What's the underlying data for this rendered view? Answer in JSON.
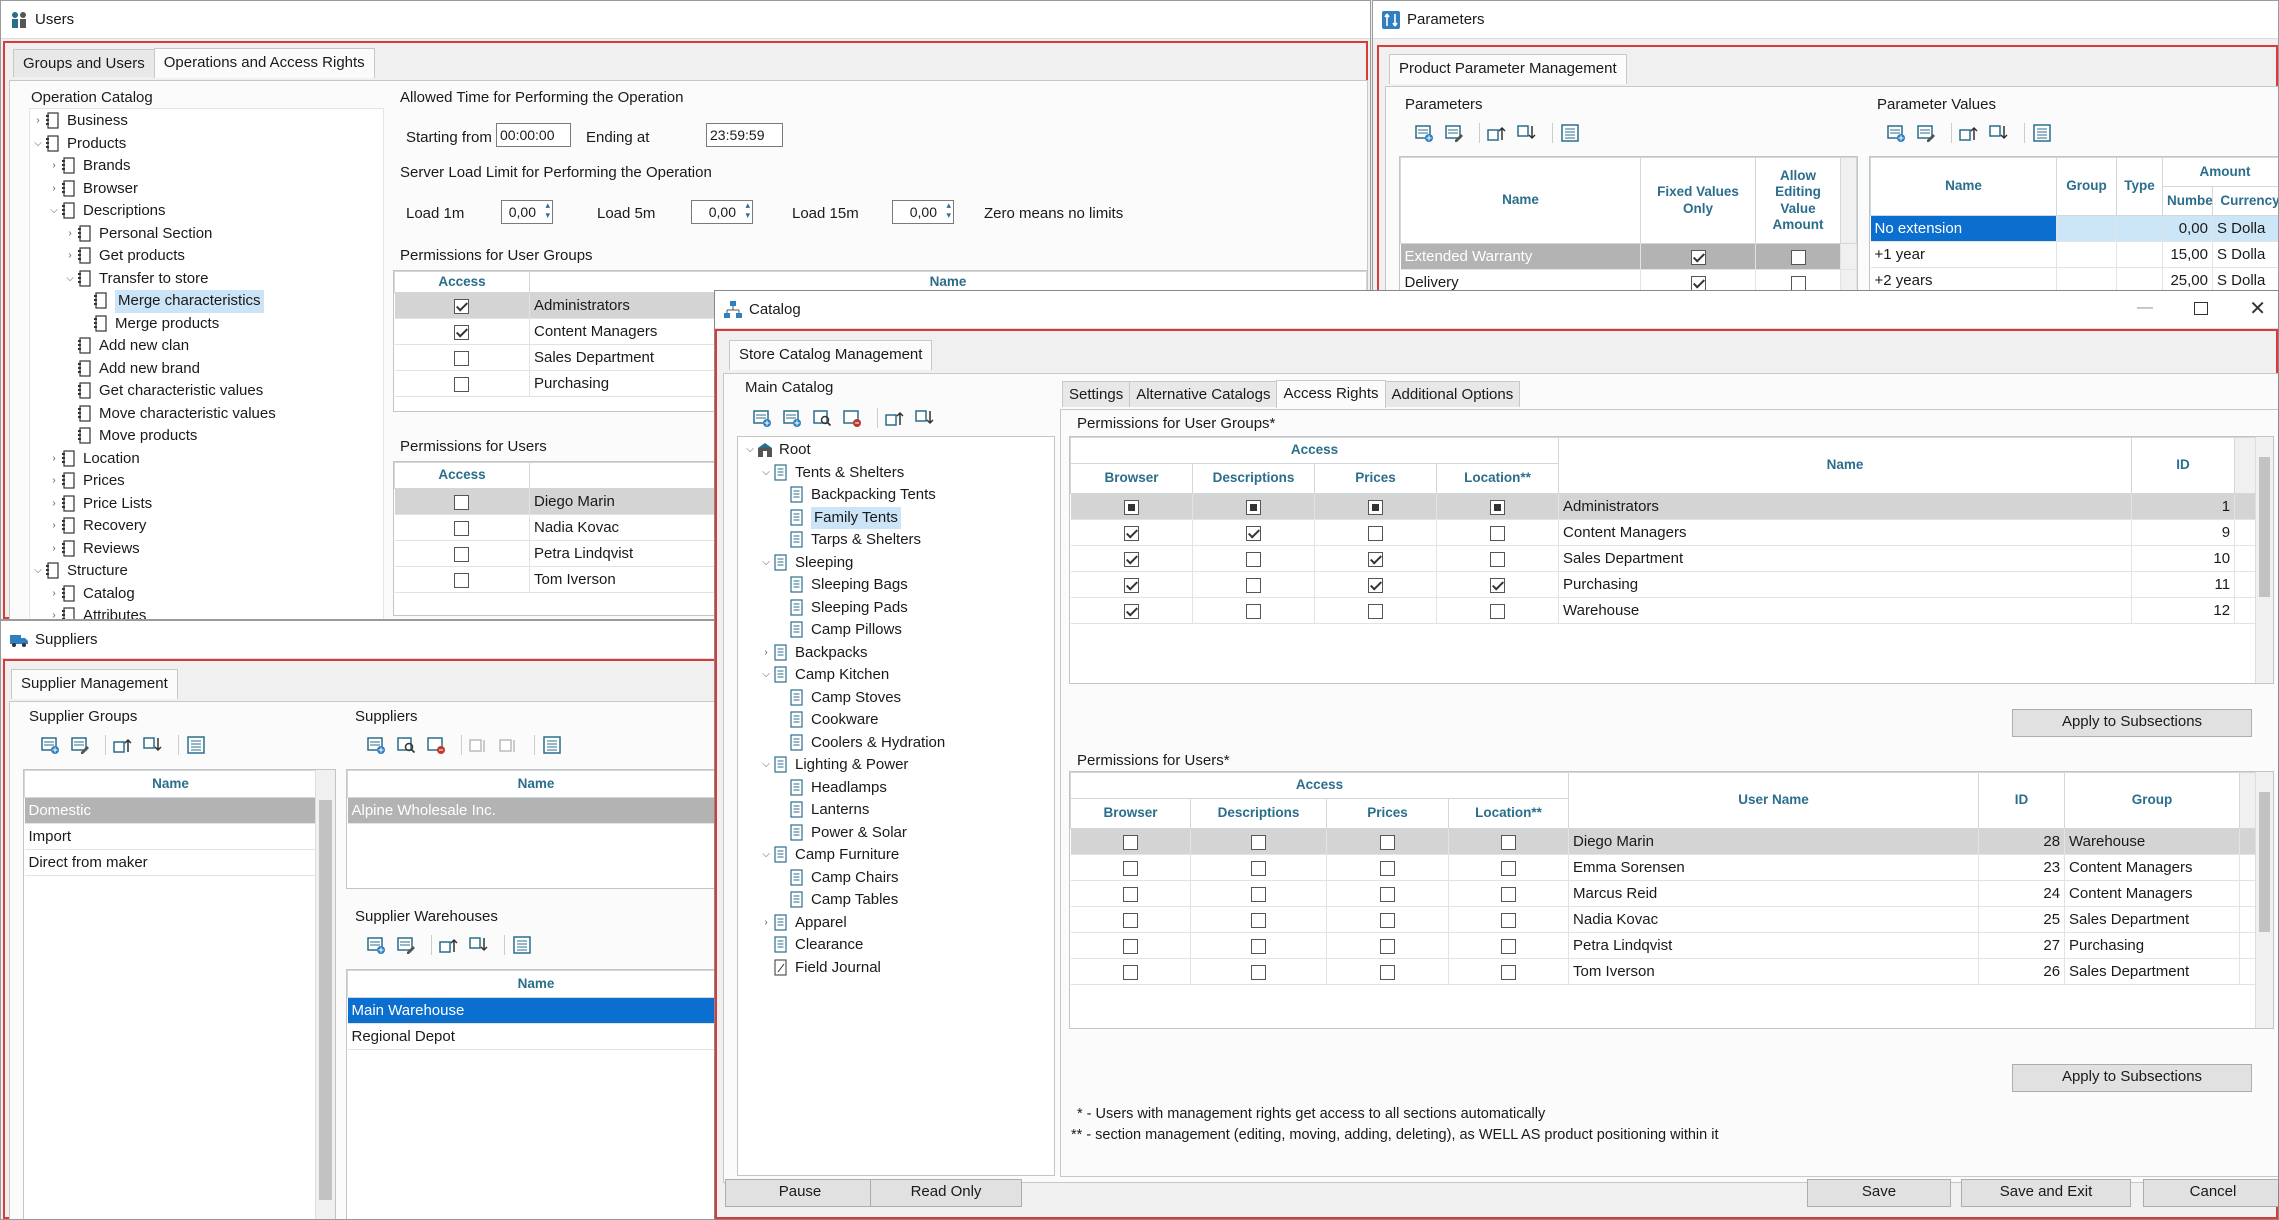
{
  "users_window": {
    "title": "Users",
    "tabs": [
      "Groups and Users",
      "Operations and Access Rights"
    ],
    "operation_catalog_label": "Operation Catalog",
    "tree": [
      {
        "label": "Business",
        "lvl": 0,
        "exp": "closed"
      },
      {
        "label": "Products",
        "lvl": 0,
        "exp": "open"
      },
      {
        "label": "Brands",
        "lvl": 1,
        "exp": "closed"
      },
      {
        "label": "Browser",
        "lvl": 1,
        "exp": "closed"
      },
      {
        "label": "Descriptions",
        "lvl": 1,
        "exp": "open"
      },
      {
        "label": "Personal Section",
        "lvl": 2,
        "exp": "closed"
      },
      {
        "label": "Get products",
        "lvl": 2,
        "exp": "closed"
      },
      {
        "label": "Transfer to store",
        "lvl": 2,
        "exp": "open"
      },
      {
        "label": "Merge characteristics",
        "lvl": 3,
        "exp": "",
        "selected": true
      },
      {
        "label": "Merge products",
        "lvl": 3,
        "exp": ""
      },
      {
        "label": "Add new clan",
        "lvl": 2,
        "exp": ""
      },
      {
        "label": "Add new brand",
        "lvl": 2,
        "exp": ""
      },
      {
        "label": "Get characteristic values",
        "lvl": 2,
        "exp": ""
      },
      {
        "label": "Move characteristic values",
        "lvl": 2,
        "exp": ""
      },
      {
        "label": "Move products",
        "lvl": 2,
        "exp": ""
      },
      {
        "label": "Location",
        "lvl": 1,
        "exp": "closed"
      },
      {
        "label": "Prices",
        "lvl": 1,
        "exp": "closed"
      },
      {
        "label": "Price Lists",
        "lvl": 1,
        "exp": "closed"
      },
      {
        "label": "Recovery",
        "lvl": 1,
        "exp": "closed"
      },
      {
        "label": "Reviews",
        "lvl": 1,
        "exp": "closed"
      },
      {
        "label": "Structure",
        "lvl": 0,
        "exp": "open"
      },
      {
        "label": "Catalog",
        "lvl": 1,
        "exp": "closed"
      },
      {
        "label": "Attributes",
        "lvl": 1,
        "exp": "closed"
      }
    ],
    "allowed_time_label": "Allowed Time for Performing the Operation",
    "starting_from_label": "Starting from",
    "starting_from_value": "00:00:00",
    "ending_at_label": "Ending at",
    "ending_at_value": "23:59:59",
    "server_load_label": "Server Load Limit for Performing the Operation",
    "load1_label": "Load 1m",
    "load1_value": "0,00",
    "load5_label": "Load 5m",
    "load5_value": "0,00",
    "load15_label": "Load 15m",
    "load15_value": "0,00",
    "zero_note": "Zero means no limits",
    "perm_groups_label": "Permissions for User Groups",
    "perm_groups_cols": [
      "Access",
      "Name"
    ],
    "perm_groups_rows": [
      {
        "access": true,
        "name": "Administrators"
      },
      {
        "access": true,
        "name": "Content Managers"
      },
      {
        "access": false,
        "name": "Sales Department"
      },
      {
        "access": false,
        "name": "Purchasing"
      }
    ],
    "perm_users_label": "Permissions for Users",
    "perm_users_cols": [
      "Access"
    ],
    "perm_users_rows": [
      {
        "access": false,
        "name": "Diego Marin"
      },
      {
        "access": false,
        "name": "Nadia Kovac"
      },
      {
        "access": false,
        "name": "Petra Lindqvist"
      },
      {
        "access": false,
        "name": "Tom Iverson"
      }
    ]
  },
  "parameters_window": {
    "title": "Parameters",
    "tab": "Product Parameter Management",
    "params_label": "Parameters",
    "params_cols": [
      "Name",
      "Fixed Values Only",
      "Allow Editing Value Amount"
    ],
    "params_rows": [
      {
        "name": "Extended Warranty",
        "fixed": true,
        "allow": false
      },
      {
        "name": "Delivery",
        "fixed": true,
        "allow": false
      }
    ],
    "values_label": "Parameter Values",
    "values_cols": [
      "Name",
      "Group",
      "Type",
      "Amount",
      "Number",
      "Currency"
    ],
    "values_rows": [
      {
        "name": "No extension",
        "number": "0,00",
        "currency": "S Dolla"
      },
      {
        "name": "+1 year",
        "number": "15,00",
        "currency": "S Dolla"
      },
      {
        "name": "+2 years",
        "number": "25,00",
        "currency": "S Dolla"
      }
    ]
  },
  "suppliers_window": {
    "title": "Suppliers",
    "tab": "Supplier Management",
    "groups_label": "Supplier Groups",
    "groups_col": "Name",
    "groups_rows": [
      "Domestic",
      "Import",
      "Direct from maker"
    ],
    "suppliers_label": "Suppliers",
    "suppliers_col": "Name",
    "suppliers_rows": [
      "Alpine Wholesale Inc."
    ],
    "warehouses_label": "Supplier Warehouses",
    "warehouses_col": "Name",
    "warehouses_rows": [
      "Main Warehouse",
      "Regional Depot"
    ]
  },
  "catalog_window": {
    "title": "Catalog",
    "tab": "Store Catalog Management",
    "main_catalog_label": "Main Catalog",
    "tree": [
      {
        "label": "Root",
        "lvl": 0,
        "exp": "open",
        "icon": "root"
      },
      {
        "label": "Tents & Shelters",
        "lvl": 1,
        "exp": "open"
      },
      {
        "label": "Backpacking Tents",
        "lvl": 2,
        "exp": ""
      },
      {
        "label": "Family Tents",
        "lvl": 2,
        "exp": "",
        "selected": true
      },
      {
        "label": "Tarps & Shelters",
        "lvl": 2,
        "exp": ""
      },
      {
        "label": "Sleeping",
        "lvl": 1,
        "exp": "open"
      },
      {
        "label": "Sleeping Bags",
        "lvl": 2,
        "exp": ""
      },
      {
        "label": "Sleeping Pads",
        "lvl": 2,
        "exp": ""
      },
      {
        "label": "Camp Pillows",
        "lvl": 2,
        "exp": ""
      },
      {
        "label": "Backpacks",
        "lvl": 1,
        "exp": "closed"
      },
      {
        "label": "Camp Kitchen",
        "lvl": 1,
        "exp": "open"
      },
      {
        "label": "Camp Stoves",
        "lvl": 2,
        "exp": ""
      },
      {
        "label": "Cookware",
        "lvl": 2,
        "exp": ""
      },
      {
        "label": "Coolers & Hydration",
        "lvl": 2,
        "exp": ""
      },
      {
        "label": "Lighting & Power",
        "lvl": 1,
        "exp": "open"
      },
      {
        "label": "Headlamps",
        "lvl": 2,
        "exp": ""
      },
      {
        "label": "Lanterns",
        "lvl": 2,
        "exp": ""
      },
      {
        "label": "Power & Solar",
        "lvl": 2,
        "exp": ""
      },
      {
        "label": "Camp Furniture",
        "lvl": 1,
        "exp": "open"
      },
      {
        "label": "Camp Chairs",
        "lvl": 2,
        "exp": ""
      },
      {
        "label": "Camp Tables",
        "lvl": 2,
        "exp": ""
      },
      {
        "label": "Apparel",
        "lvl": 1,
        "exp": "closed"
      },
      {
        "label": "Clearance",
        "lvl": 1,
        "exp": ""
      },
      {
        "label": "Field Journal",
        "lvl": 1,
        "exp": "",
        "icon": "journal"
      }
    ],
    "right_tabs": [
      "Settings",
      "Alternative Catalogs",
      "Access Rights",
      "Additional Options"
    ],
    "groups_perm_label": "Permissions for User Groups*",
    "access_header": "Access",
    "groups_cols": [
      "Browser",
      "Descriptions",
      "Prices",
      "Location**",
      "Name",
      "ID"
    ],
    "groups_rows": [
      {
        "b": "sq",
        "d": "sq",
        "p": "sq",
        "l": "sq",
        "name": "Administrators",
        "id": "1"
      },
      {
        "b": "on",
        "d": "on",
        "p": "off",
        "l": "off",
        "name": "Content Managers",
        "id": "9"
      },
      {
        "b": "on",
        "d": "off",
        "p": "on",
        "l": "off",
        "name": "Sales Department",
        "id": "10"
      },
      {
        "b": "on",
        "d": "off",
        "p": "on",
        "l": "on",
        "name": "Purchasing",
        "id": "11"
      },
      {
        "b": "on",
        "d": "off",
        "p": "off",
        "l": "off",
        "name": "Warehouse",
        "id": "12"
      }
    ],
    "apply_label": "Apply to Subsections",
    "users_perm_label": "Permissions for Users*",
    "users_cols": [
      "Browser",
      "Descriptions",
      "Prices",
      "Location**",
      "User Name",
      "ID",
      "Group"
    ],
    "users_rows": [
      {
        "name": "Diego Marin",
        "id": "28",
        "group": "Warehouse"
      },
      {
        "name": "Emma Sorensen",
        "id": "23",
        "group": "Content Managers"
      },
      {
        "name": "Marcus Reid",
        "id": "24",
        "group": "Content Managers"
      },
      {
        "name": "Nadia Kovac",
        "id": "25",
        "group": "Sales Department"
      },
      {
        "name": "Petra Lindqvist",
        "id": "27",
        "group": "Purchasing"
      },
      {
        "name": "Tom Iverson",
        "id": "26",
        "group": "Sales Department"
      }
    ],
    "note1": "* - Users with management rights get access to all sections automatically",
    "note2": "** - section management (editing, moving, adding, deleting), as WELL AS product positioning within it",
    "buttons": {
      "pause": "Pause",
      "read_only": "Read Only",
      "save": "Save",
      "save_exit": "Save and Exit",
      "cancel": "Cancel"
    }
  }
}
